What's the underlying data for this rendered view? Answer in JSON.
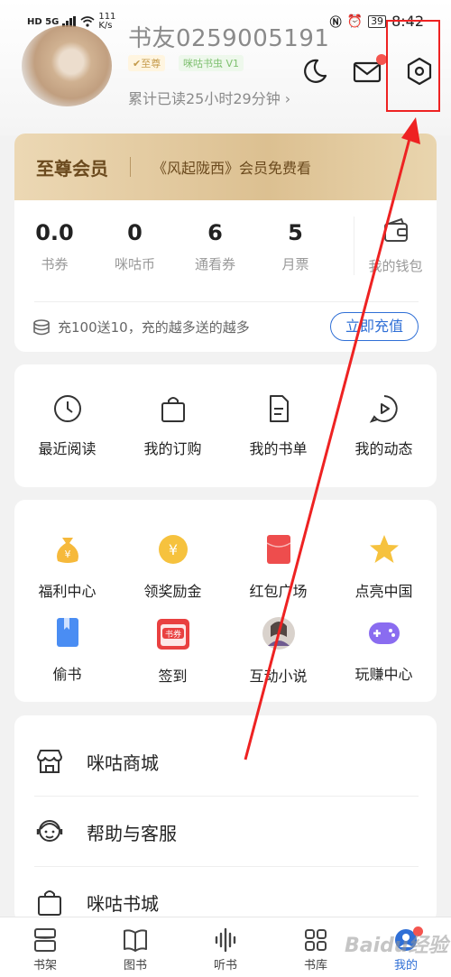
{
  "status_bar": {
    "left": "HD 5G",
    "speed": "111 K/s",
    "battery": "39",
    "time": "8:42"
  },
  "profile": {
    "username": "书友0259005191",
    "vip_badge": "✔至尊",
    "level_badge": "咪咕书虫 V1",
    "read_time": "累计已读25小时29分钟 ›"
  },
  "vip": {
    "title": "至尊会员",
    "promo": "《风起陇西》会员免费看",
    "stats": [
      {
        "value": "0.0",
        "label": "书券"
      },
      {
        "value": "0",
        "label": "咪咕币"
      },
      {
        "value": "6",
        "label": "通看券"
      },
      {
        "value": "5",
        "label": "月票"
      }
    ],
    "wallet": "我的钱包",
    "recharge_text": "充100送10，充的越多送的越多",
    "recharge_button": "立即充值"
  },
  "actions": [
    {
      "label": "最近阅读",
      "icon": "clock-icon"
    },
    {
      "label": "我的订购",
      "icon": "bag-icon"
    },
    {
      "label": "我的书单",
      "icon": "document-icon"
    },
    {
      "label": "我的动态",
      "icon": "play-bubble-icon"
    }
  ],
  "welfare": [
    {
      "label": "福利中心",
      "icon": "money-bag-icon"
    },
    {
      "label": "领奖励金",
      "icon": "yuan-coin-icon"
    },
    {
      "label": "红包广场",
      "icon": "red-envelope-icon"
    },
    {
      "label": "点亮中国",
      "icon": "star-icon"
    },
    {
      "label": "偷书",
      "icon": "book-icon"
    },
    {
      "label": "签到",
      "icon": "checkin-calendar-icon"
    },
    {
      "label": "互动小说",
      "icon": "novel-avatar-icon"
    },
    {
      "label": "玩赚中心",
      "icon": "gamepad-icon"
    }
  ],
  "checkin_badge": "书券",
  "menu": [
    {
      "label": "咪咕商城",
      "icon": "store-icon"
    },
    {
      "label": "帮助与客服",
      "icon": "customer-service-icon"
    },
    {
      "label": "咪咕书城",
      "icon": "shopping-bag-icon"
    }
  ],
  "nav": [
    {
      "label": "书架",
      "icon": "bookshelf-icon"
    },
    {
      "label": "图书",
      "icon": "open-book-icon"
    },
    {
      "label": "听书",
      "icon": "audio-wave-icon"
    },
    {
      "label": "书库",
      "icon": "grid-icon"
    },
    {
      "label": "我的",
      "icon": "profile-icon"
    }
  ],
  "watermark": "Baidu经验",
  "colors": {
    "accent": "#2f6fd6",
    "vip_gold": "#dcc091",
    "badge_red": "#f4554f",
    "annotation_red": "#ee2222"
  }
}
